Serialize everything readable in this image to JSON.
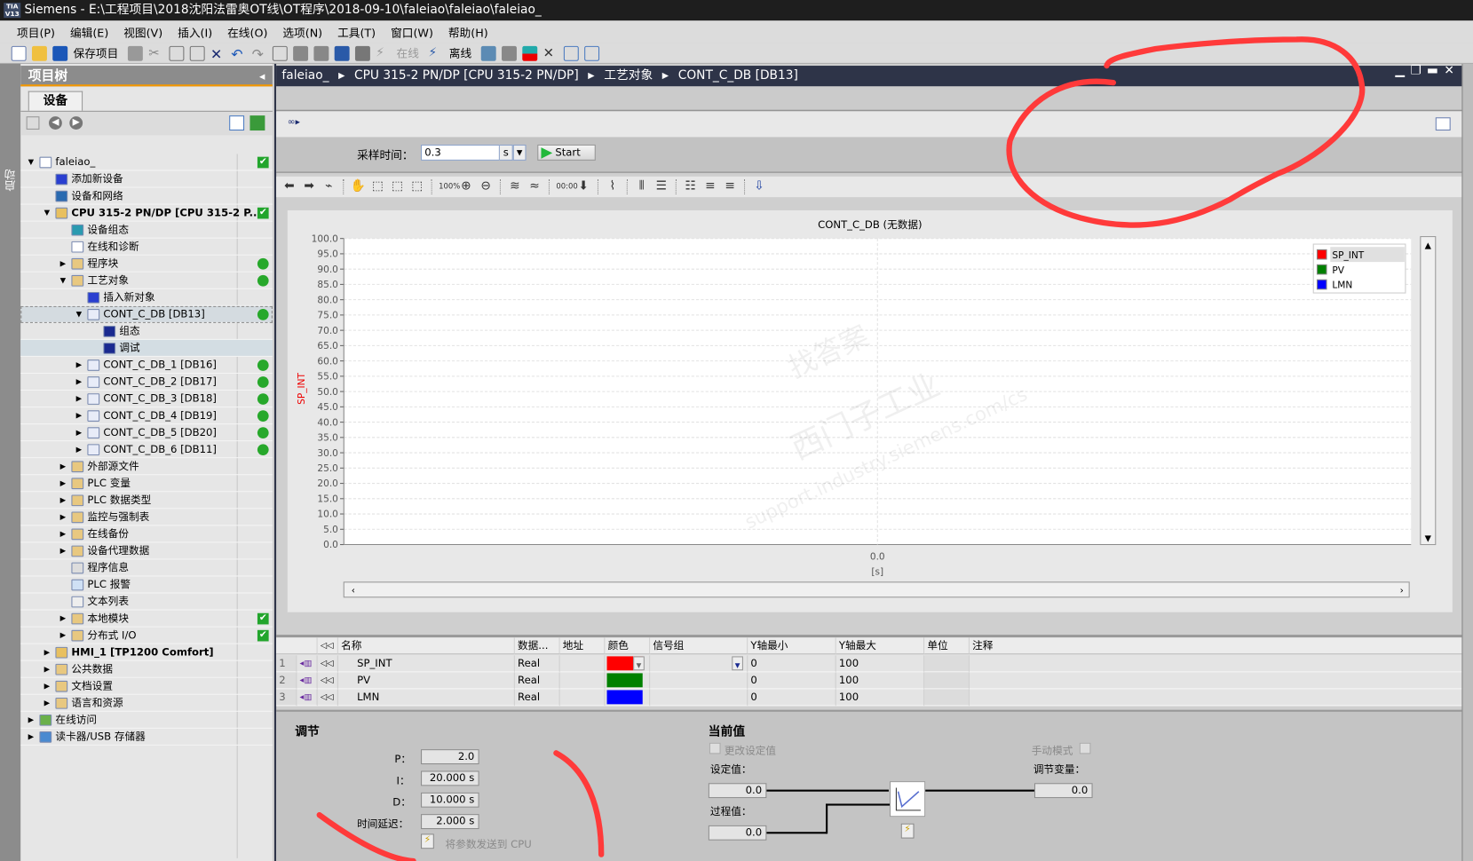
{
  "window": {
    "title": "Siemens  -  E:\\工程项目\\2018沈阳法雷奥OT线\\OT程序\\2018-09-10\\faleiao\\faleiao\\faleiao_",
    "logo": "TIA V13"
  },
  "menu": [
    "项目(P)",
    "编辑(E)",
    "视图(V)",
    "插入(I)",
    "在线(O)",
    "选项(N)",
    "工具(T)",
    "窗口(W)",
    "帮助(H)"
  ],
  "toolbar": {
    "save_label": "保存项目",
    "online_label": "在线",
    "offline_label": "离线"
  },
  "left_strip": {
    "label": "启动"
  },
  "project_tree": {
    "title": "项目树",
    "tab": "设备",
    "items": [
      {
        "label": "faleiao_",
        "level": 0,
        "expand": "open",
        "status": "check",
        "icon": "project-icon"
      },
      {
        "label": "添加新设备",
        "level": 1,
        "icon": "add-device-icon"
      },
      {
        "label": "设备和网络",
        "level": 1,
        "icon": "network-icon"
      },
      {
        "label": "CPU 315-2 PN/DP [CPU 315-2 P...",
        "level": 1,
        "expand": "open",
        "status": "check",
        "icon": "cpu-icon",
        "bold": true
      },
      {
        "label": "设备组态",
        "level": 2,
        "icon": "device-config-icon"
      },
      {
        "label": "在线和诊断",
        "level": 2,
        "icon": "diagnostics-icon"
      },
      {
        "label": "程序块",
        "level": 2,
        "expand": "closed",
        "status": "dot",
        "icon": "folder-icon"
      },
      {
        "label": "工艺对象",
        "level": 2,
        "expand": "open",
        "status": "dot",
        "icon": "folder-icon"
      },
      {
        "label": "插入新对象",
        "level": 3,
        "icon": "add-object-icon"
      },
      {
        "label": "CONT_C_DB [DB13]",
        "level": 3,
        "expand": "open",
        "status": "dot",
        "icon": "pid-icon",
        "selected": true
      },
      {
        "label": "组态",
        "level": 4,
        "icon": "config-icon"
      },
      {
        "label": "调试",
        "level": 4,
        "icon": "commissioning-icon",
        "active": true
      },
      {
        "label": "CONT_C_DB_1 [DB16]",
        "level": 3,
        "expand": "closed",
        "status": "dot",
        "icon": "pid-icon"
      },
      {
        "label": "CONT_C_DB_2 [DB17]",
        "level": 3,
        "expand": "closed",
        "status": "dot",
        "icon": "pid-icon"
      },
      {
        "label": "CONT_C_DB_3 [DB18]",
        "level": 3,
        "expand": "closed",
        "status": "dot",
        "icon": "pid-icon"
      },
      {
        "label": "CONT_C_DB_4 [DB19]",
        "level": 3,
        "expand": "closed",
        "status": "dot",
        "icon": "pid-icon"
      },
      {
        "label": "CONT_C_DB_5 [DB20]",
        "level": 3,
        "expand": "closed",
        "status": "dot",
        "icon": "pid-icon"
      },
      {
        "label": "CONT_C_DB_6 [DB11]",
        "level": 3,
        "expand": "closed",
        "status": "dot",
        "icon": "pid-icon"
      },
      {
        "label": "外部源文件",
        "level": 2,
        "expand": "closed",
        "icon": "folder-icon"
      },
      {
        "label": "PLC 变量",
        "level": 2,
        "expand": "closed",
        "icon": "folder-icon"
      },
      {
        "label": "PLC 数据类型",
        "level": 2,
        "expand": "closed",
        "icon": "folder-icon"
      },
      {
        "label": "监控与强制表",
        "level": 2,
        "expand": "closed",
        "icon": "folder-icon"
      },
      {
        "label": "在线备份",
        "level": 2,
        "expand": "closed",
        "icon": "folder-icon"
      },
      {
        "label": "设备代理数据",
        "level": 2,
        "expand": "closed",
        "icon": "folder-icon"
      },
      {
        "label": "程序信息",
        "level": 2,
        "icon": "info-icon"
      },
      {
        "label": "PLC 报警",
        "level": 2,
        "icon": "alarm-icon"
      },
      {
        "label": "文本列表",
        "level": 2,
        "icon": "text-list-icon"
      },
      {
        "label": "本地模块",
        "level": 2,
        "expand": "closed",
        "status": "check",
        "icon": "folder-icon"
      },
      {
        "label": "分布式 I/O",
        "level": 2,
        "expand": "closed",
        "status": "check",
        "icon": "folder-icon"
      },
      {
        "label": "HMI_1 [TP1200 Comfort]",
        "level": 1,
        "expand": "closed",
        "icon": "hmi-icon",
        "bold": true
      },
      {
        "label": "公共数据",
        "level": 1,
        "expand": "closed",
        "icon": "folder-icon"
      },
      {
        "label": "文档设置",
        "level": 1,
        "expand": "closed",
        "icon": "folder-icon"
      },
      {
        "label": "语言和资源",
        "level": 1,
        "expand": "closed",
        "icon": "folder-icon"
      },
      {
        "label": "在线访问",
        "level": 0,
        "expand": "closed",
        "icon": "online-access-icon"
      },
      {
        "label": "读卡器/USB 存储器",
        "level": 0,
        "expand": "closed",
        "icon": "card-reader-icon"
      }
    ]
  },
  "breadcrumb": [
    "faleiao_",
    "CPU 315-2 PN/DP [CPU 315-2 PN/DP]",
    "工艺对象",
    "CONT_C_DB [DB13]"
  ],
  "sampling": {
    "label": "采样时间：",
    "value": "0.3",
    "unit": "s",
    "start_label": "Start"
  },
  "chart_data": {
    "type": "line",
    "title": "CONT_C_DB (无数据)",
    "ylabel": "SP_INT",
    "ylim": [
      0,
      100
    ],
    "yticks": [
      "0.0",
      "5.0",
      "10.0",
      "15.0",
      "20.0",
      "25.0",
      "30.0",
      "35.0",
      "40.0",
      "45.0",
      "50.0",
      "55.0",
      "60.0",
      "65.0",
      "70.0",
      "75.0",
      "80.0",
      "85.0",
      "90.0",
      "95.0",
      "100.0"
    ],
    "xticks": [
      "0.0"
    ],
    "xunit": "[s]",
    "grid": true,
    "legend_placement": "top-right",
    "series": [
      {
        "name": "SP_INT",
        "color": "#ff0000",
        "values": []
      },
      {
        "name": "PV",
        "color": "#008000",
        "values": []
      },
      {
        "name": "LMN",
        "color": "#0000ff",
        "values": []
      }
    ],
    "watermark": [
      "西门子工业",
      "support.industry.siemens.com/cs",
      "找答案"
    ]
  },
  "signal_table": {
    "headers": [
      "名称",
      "数据...",
      "地址",
      "颜色",
      "信号组",
      "Y轴最小",
      "Y轴最大",
      "单位",
      "注释"
    ],
    "rows": [
      {
        "num": "1",
        "name": "SP_INT",
        "type": "Real",
        "color": "#ff0000",
        "ymin": "0",
        "ymax": "100"
      },
      {
        "num": "2",
        "name": "PV",
        "type": "Real",
        "color": "#008000",
        "ymin": "0",
        "ymax": "100"
      },
      {
        "num": "3",
        "name": "LMN",
        "type": "Real",
        "color": "#0000ff",
        "ymin": "0",
        "ymax": "100"
      }
    ]
  },
  "tuning": {
    "title": "调节",
    "p_label": "P：",
    "p_value": "2.0",
    "i_label": "I：",
    "i_value": "20.000  s",
    "d_label": "D：",
    "d_value": "10.000  s",
    "delay_label": "时间延迟：",
    "delay_value": "2.000  s",
    "send_label": "将参数发送到 CPU"
  },
  "current": {
    "title": "当前值",
    "change_sp_label": "更改设定值",
    "setpoint_label": "设定值：",
    "setpoint_value": "0.0",
    "pv_label": "过程值：",
    "pv_value": "0.0",
    "manual_label": "手动模式",
    "output_label": "调节变量：",
    "output_value": "0.0"
  }
}
